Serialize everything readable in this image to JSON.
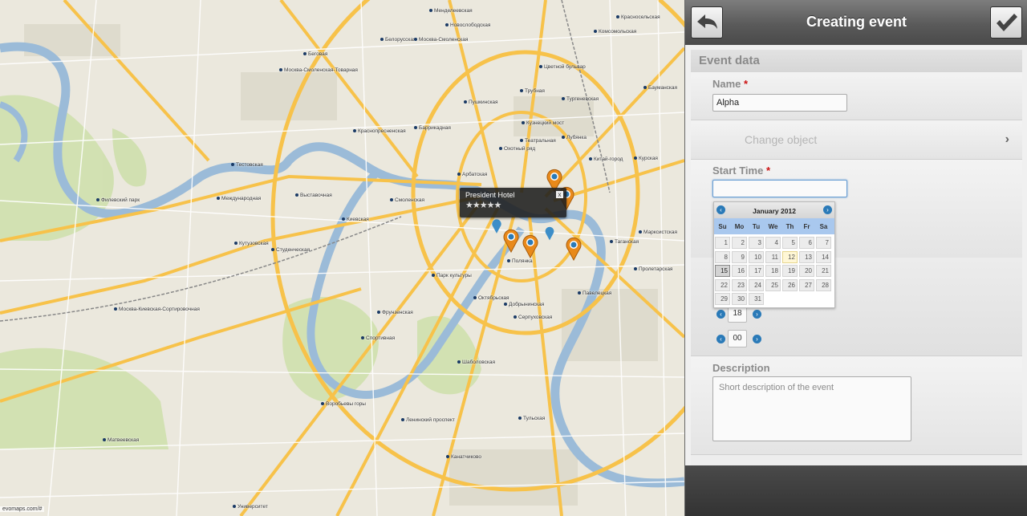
{
  "map": {
    "info_window": {
      "title": "President Hotel",
      "stars": "★★★★★",
      "close": "x"
    },
    "copyright": "evomaps.com/#",
    "labels": [
      {
        "text": "Менделеевская",
        "cls": "l1"
      },
      {
        "text": "Новослободская",
        "cls": "l2"
      },
      {
        "text": "Белорусская",
        "cls": "l3"
      },
      {
        "text": "Москва-Смоленская",
        "cls": "l4"
      },
      {
        "text": "Беговая",
        "cls": "l5"
      },
      {
        "text": "Москва-Смоленская-Товарная",
        "cls": "l6"
      },
      {
        "text": "Краснопресненская",
        "cls": "l7"
      },
      {
        "text": "Баррикадная",
        "cls": "l8"
      },
      {
        "text": "Цветной бульвар",
        "cls": "l9"
      },
      {
        "text": "Трубная",
        "cls": "l10"
      },
      {
        "text": "Тургеневская",
        "cls": "l11"
      },
      {
        "text": "Пушкинская",
        "cls": "l12"
      },
      {
        "text": "Кузнецкий мост",
        "cls": "l13"
      },
      {
        "text": "Лубянка",
        "cls": "l14"
      },
      {
        "text": "Театральная",
        "cls": "l15"
      },
      {
        "text": "Охотный ряд",
        "cls": "l16"
      },
      {
        "text": "Китай-город",
        "cls": "l17"
      },
      {
        "text": "Арбатская",
        "cls": "l18"
      },
      {
        "text": "Смоленская",
        "cls": "l19"
      },
      {
        "text": "Тестовская",
        "cls": "l20"
      },
      {
        "text": "Выставочная",
        "cls": "l21"
      },
      {
        "text": "Международная",
        "cls": "l22"
      },
      {
        "text": "Филевский парк",
        "cls": "l23"
      },
      {
        "text": "Киевская",
        "cls": "l24"
      },
      {
        "text": "Студенческая",
        "cls": "l25"
      },
      {
        "text": "Кутузовская",
        "cls": "l26"
      },
      {
        "text": "Парк культуры",
        "cls": "l27"
      },
      {
        "text": "Фрунзенская",
        "cls": "l28"
      },
      {
        "text": "Октябрьская",
        "cls": "l29"
      },
      {
        "text": "Добрынинская",
        "cls": "l30"
      },
      {
        "text": "Серпуховская",
        "cls": "l31"
      },
      {
        "text": "Павелецкая",
        "cls": "l32"
      },
      {
        "text": "Таганская",
        "cls": "l33"
      },
      {
        "text": "Москва-Киевская-Сортировочная",
        "cls": "l34"
      },
      {
        "text": "Спортивная",
        "cls": "l35"
      },
      {
        "text": "Воробьевы горы",
        "cls": "l36"
      },
      {
        "text": "Ленинский проспект",
        "cls": "l37"
      },
      {
        "text": "Шаболовская",
        "cls": "l38"
      },
      {
        "text": "Тульская",
        "cls": "l39"
      },
      {
        "text": "Канатчиково",
        "cls": "l40"
      },
      {
        "text": "Университет",
        "cls": "l41"
      },
      {
        "text": "Матвеевская",
        "cls": "l42"
      },
      {
        "text": "Полянка",
        "cls": "l43"
      },
      {
        "text": "Курская",
        "cls": "l44"
      },
      {
        "text": "Пролетарская",
        "cls": "l45"
      },
      {
        "text": "Марксистская",
        "cls": "l46"
      },
      {
        "text": "Комсомольская",
        "cls": "l47"
      },
      {
        "text": "Красносельская",
        "cls": "l48"
      },
      {
        "text": "Бауманская",
        "cls": "l49"
      }
    ]
  },
  "panel": {
    "title": "Creating event",
    "back_label": "back-arrow",
    "ok_label": "checkmark",
    "section": "Event data",
    "name_label": "Name",
    "required_mark": "*",
    "name_value": "Alpha",
    "change_object": "Change object",
    "change_arrow": "›",
    "start_time_label": "Start Time",
    "start_time_value": "",
    "hour": "18",
    "minute": "00",
    "description_label": "Description",
    "description_placeholder": "Short description of the event"
  },
  "calendar": {
    "month": "January 2012",
    "prev": "‹",
    "next": "›",
    "dow": [
      "Su",
      "Mo",
      "Tu",
      "We",
      "Th",
      "Fr",
      "Sa"
    ],
    "days": [
      "1",
      "2",
      "3",
      "4",
      "5",
      "6",
      "7",
      "8",
      "9",
      "10",
      "11",
      "12",
      "13",
      "14",
      "15",
      "16",
      "17",
      "18",
      "19",
      "20",
      "21",
      "22",
      "23",
      "24",
      "25",
      "26",
      "27",
      "28",
      "29",
      "30",
      "31"
    ],
    "today": "12",
    "selected": "15"
  },
  "colors": {
    "accent": "#2a7ab8",
    "pin": "#e8891a",
    "road": "#f7c24a",
    "river": "#9bbbd8"
  }
}
